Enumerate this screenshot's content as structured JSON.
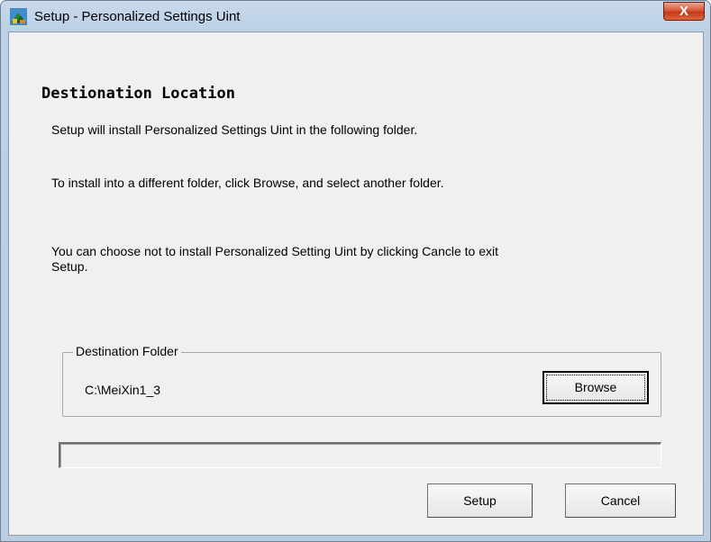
{
  "window": {
    "title": "Setup - Personalized Settings Uint",
    "close_label": "X"
  },
  "page": {
    "heading": "Destionation Location",
    "line1": "Setup will install Personalized Settings Uint in the following folder.",
    "line2": "To install into a different folder, click Browse, and select another folder.",
    "line3a": "You can choose not to install Personalized Setting Uint by clicking Cancle to exit",
    "line3b": "Setup."
  },
  "destination": {
    "group_label": "Destination Folder",
    "path": "C:\\MeiXin1_3",
    "browse_label": "Browse"
  },
  "progress": {
    "value": 0
  },
  "buttons": {
    "setup_label": "Setup",
    "cancel_label": "Cancel"
  },
  "icons": {
    "app": "installer-icon",
    "close": "close-icon"
  },
  "colors": {
    "close_button": "#c4381a",
    "dialog_background": "#f0f0f0",
    "frame": "#bcd0e6"
  }
}
